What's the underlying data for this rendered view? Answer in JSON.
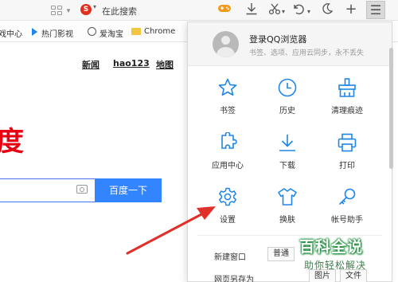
{
  "toolbar": {
    "search_placeholder": "在此搜索",
    "search_engine_glyph": "S",
    "icons": [
      "apps-grid-icon",
      "search-engine-icon",
      "game-icon",
      "download-icon",
      "cut-icon",
      "undo-icon",
      "night-mode-icon",
      "new-tab-icon",
      "menu-icon"
    ]
  },
  "bookmarks": {
    "items": [
      {
        "label": "戏中心"
      },
      {
        "label": "热门影视",
        "icon": "play-icon"
      },
      {
        "label": "爱淘宝",
        "icon": "globe-icon"
      },
      {
        "label": "Chrome",
        "icon": "folder-icon"
      }
    ]
  },
  "page": {
    "nav_links": [
      "新闻",
      "hao123",
      "地图"
    ],
    "big_char": "度",
    "search_button": "百度一下",
    "camera_icon": "camera-icon"
  },
  "menu": {
    "login_title": "登录QQ浏览器",
    "login_subtitle": "书签、选项、应用云同步，永不丢失",
    "items": [
      {
        "label": "书签",
        "icon": "star-icon"
      },
      {
        "label": "历史",
        "icon": "clock-icon"
      },
      {
        "label": "清理痕迹",
        "icon": "broom-icon"
      },
      {
        "label": "应用中心",
        "icon": "puzzle-icon"
      },
      {
        "label": "下载",
        "icon": "download-icon"
      },
      {
        "label": "打印",
        "icon": "printer-icon"
      },
      {
        "label": "设置",
        "icon": "gear-icon"
      },
      {
        "label": "换肤",
        "icon": "shirt-icon"
      },
      {
        "label": "帐号助手",
        "icon": "key-icon"
      }
    ],
    "new_window_label": "新建窗口",
    "new_window_option": "普通",
    "save_page_label": "网页另存为",
    "save_image_option": "图片",
    "save_file_option": "文件"
  },
  "watermark": {
    "title": "百科全说",
    "subtitle": "助你轻松解决"
  },
  "colors": {
    "accent_blue": "#3385ff",
    "icon_blue": "#1e86e8",
    "arrow_red": "#e0302a",
    "big_char_red": "#e60012"
  }
}
